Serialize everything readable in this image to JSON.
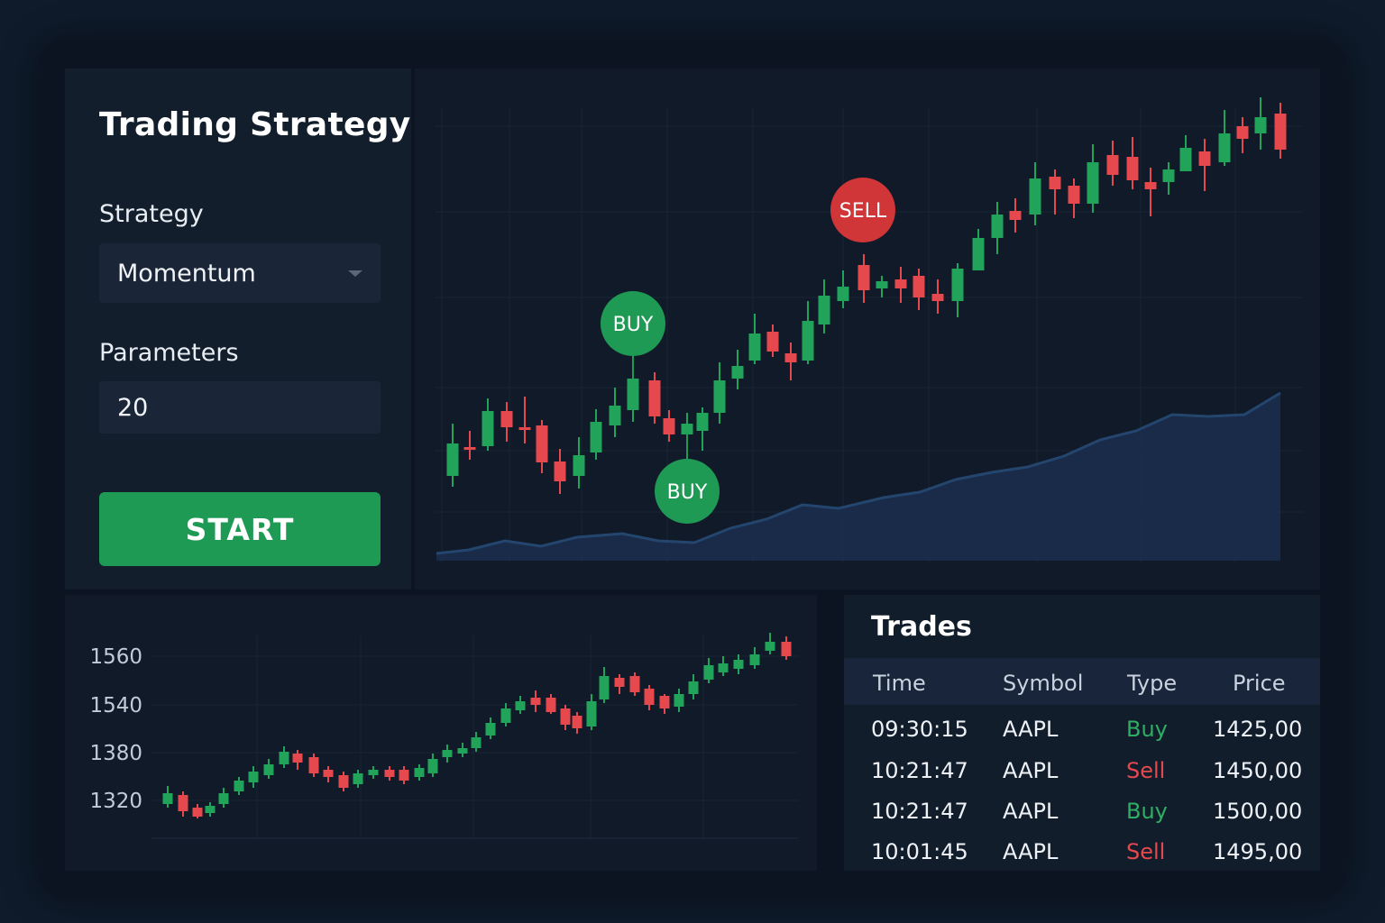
{
  "strategy_panel": {
    "title": "Trading Strategy",
    "strategy_label": "Strategy",
    "strategy_value": "Momentum",
    "parameters_label": "Parameters",
    "parameters_value": "20",
    "start_label": "START"
  },
  "main_chart": {
    "markers": {
      "buy1": "BUY",
      "buy2": "BUY",
      "sell": "SELL"
    }
  },
  "mini_chart": {
    "y_ticks": [
      "1560",
      "1540",
      "1380",
      "1320"
    ]
  },
  "trades": {
    "title": "Trades",
    "columns": [
      "Time",
      "Symbol",
      "Type",
      "Price"
    ],
    "rows": [
      {
        "time": "09:30:15",
        "symbol": "AAPL",
        "type": "Buy",
        "price": "1425,00"
      },
      {
        "time": "10:21:47",
        "symbol": "AAPL",
        "type": "Sell",
        "price": "1450,00"
      },
      {
        "time": "10:21:47",
        "symbol": "AAPL",
        "type": "Buy",
        "price": "1500,00"
      },
      {
        "time": "10:01:45",
        "symbol": "AAPL",
        "type": "Sell",
        "price": "1495,00"
      }
    ]
  },
  "colors": {
    "up": "#21a35a",
    "down": "#e5484d",
    "accent": "#1f9a55",
    "area": "#1b3050"
  }
}
